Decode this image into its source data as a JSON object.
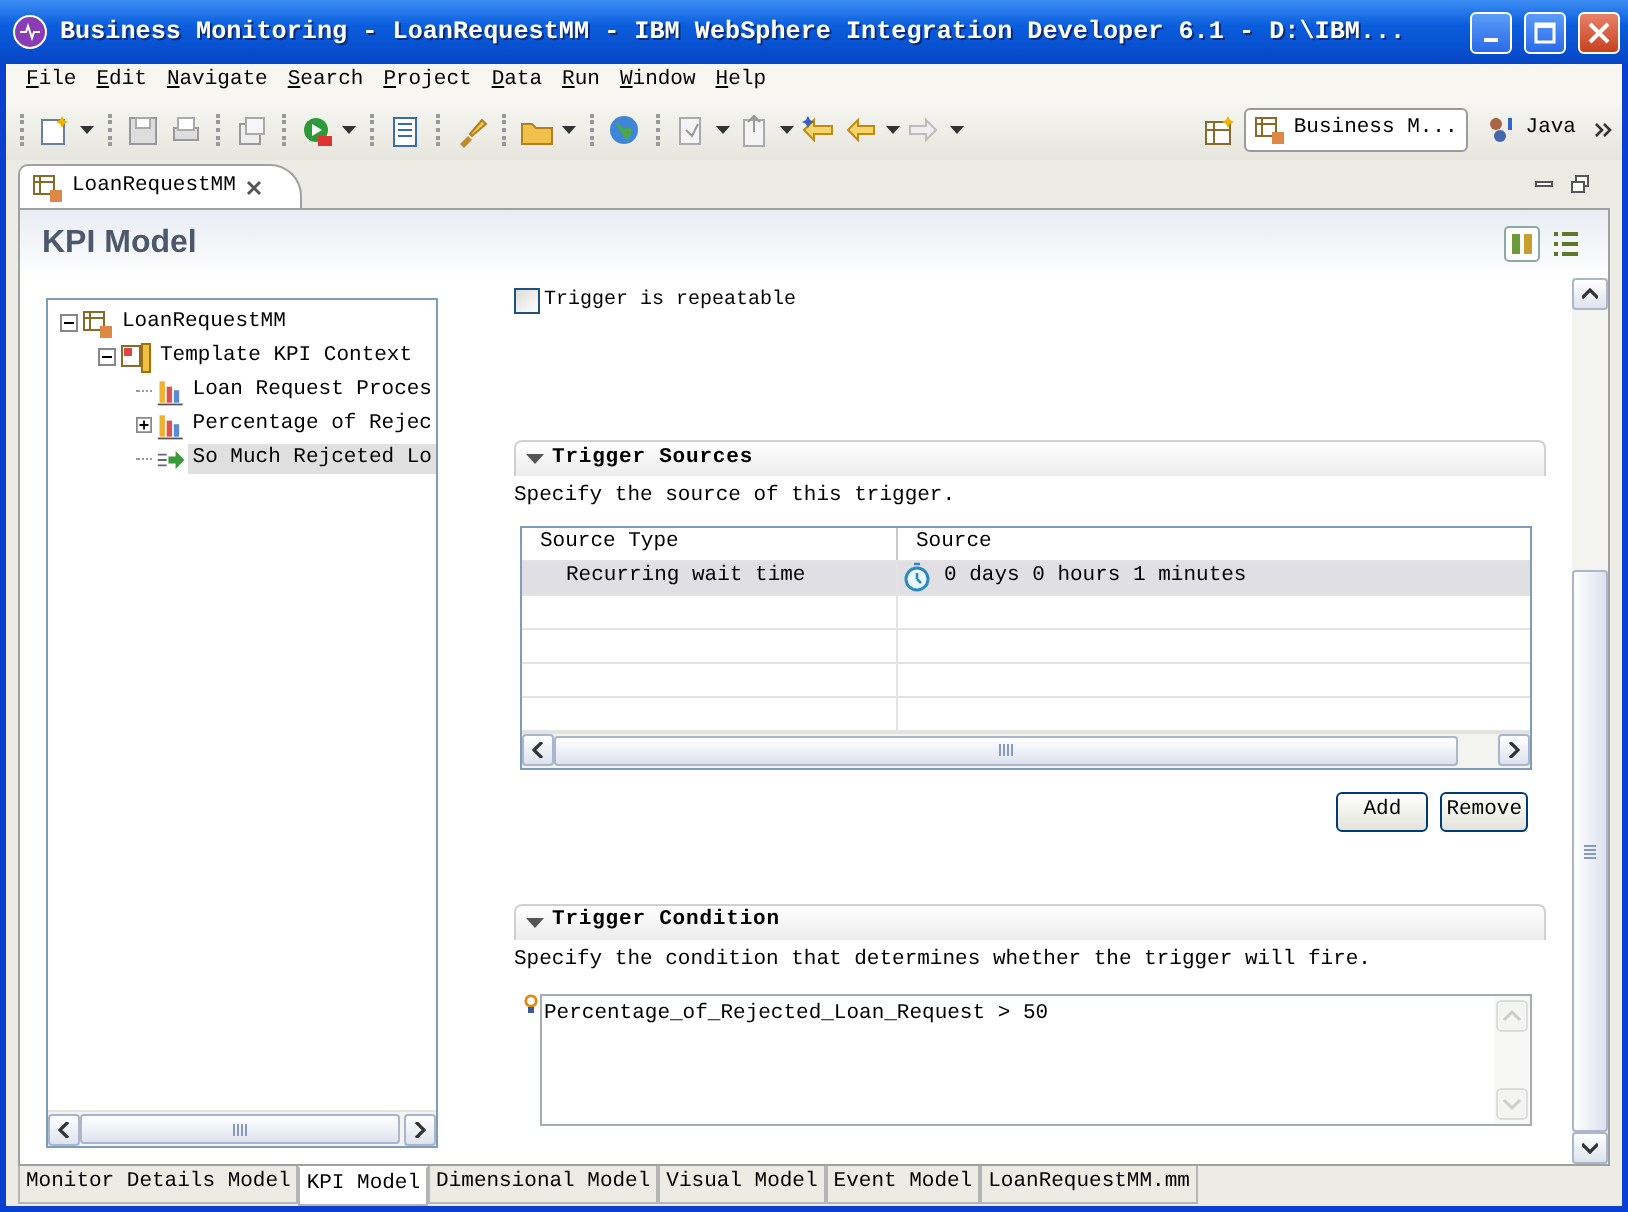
{
  "window": {
    "title": "Business Monitoring - LoanRequestMM - IBM WebSphere Integration Developer 6.1 - D:\\IBM..."
  },
  "menu": [
    {
      "label": "File"
    },
    {
      "label": "Edit"
    },
    {
      "label": "Navigate"
    },
    {
      "label": "Search"
    },
    {
      "label": "Project"
    },
    {
      "label": "Data"
    },
    {
      "label": "Run"
    },
    {
      "label": "Window"
    },
    {
      "label": "Help"
    }
  ],
  "perspectives": [
    {
      "label": "Business M...",
      "selected": true
    },
    {
      "label": "Java",
      "selected": false
    }
  ],
  "editor_tab": {
    "label": "LoanRequestMM"
  },
  "page_title": "KPI Model",
  "tree": [
    {
      "label": "LoanRequestMM",
      "kind": "model",
      "expanded": true,
      "selected": false,
      "children": [
        {
          "label": "Template KPI Context",
          "kind": "context",
          "expanded": true,
          "selected": false,
          "children": [
            {
              "label": "Loan Request Proces",
              "kind": "kpi",
              "selected": false
            },
            {
              "label": "Percentage of Rejec",
              "kind": "kpi",
              "expanded": false,
              "selected": false
            },
            {
              "label": "So Much Rejceted Lo",
              "kind": "trigger",
              "selected": true
            }
          ]
        }
      ]
    }
  ],
  "repeatable": {
    "label": "Trigger is repeatable",
    "checked": false
  },
  "trigger_sources": {
    "title": "Trigger Sources",
    "expanded": true,
    "description": "Specify the source of this trigger.",
    "columns": [
      "Source Type",
      "Source"
    ],
    "rows": [
      {
        "source_type": "Recurring wait time",
        "source": "0 days 0 hours 1 minutes",
        "selected": true
      }
    ],
    "buttons": [
      "Add",
      "Remove"
    ]
  },
  "trigger_condition": {
    "title": "Trigger Condition",
    "expanded": true,
    "description": "Specify the condition that determines whether the trigger will fire.",
    "expression": "Percentage_of_Rejected_Loan_Request > 50"
  },
  "bottom_tabs": [
    {
      "label": "Monitor Details Model",
      "selected": false
    },
    {
      "label": "KPI Model",
      "selected": true
    },
    {
      "label": "Dimensional Model",
      "selected": false
    },
    {
      "label": "Visual Model",
      "selected": false
    },
    {
      "label": "Event Model",
      "selected": false
    },
    {
      "label": "LoanRequestMM.mm",
      "selected": false
    }
  ]
}
